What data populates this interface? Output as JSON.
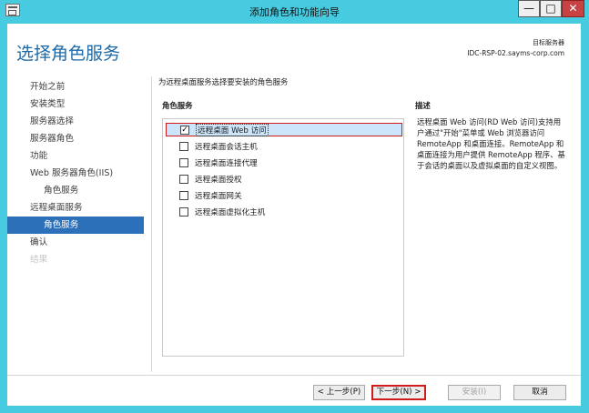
{
  "window": {
    "title": "添加角色和功能向导",
    "min_glyph": "—",
    "max_glyph": "□",
    "close_glyph": "✕",
    "icon": "server-manager-icon"
  },
  "header": {
    "page_title": "选择角色服务",
    "destination_label": "目标服务器",
    "destination_server": "IDC-RSP-02.sayms-corp.com"
  },
  "nav": {
    "items": [
      {
        "label": "开始之前",
        "state": "normal"
      },
      {
        "label": "安装类型",
        "state": "normal"
      },
      {
        "label": "服务器选择",
        "state": "normal"
      },
      {
        "label": "服务器角色",
        "state": "normal"
      },
      {
        "label": "功能",
        "state": "normal"
      },
      {
        "label": "Web 服务器角色(IIS)",
        "state": "normal"
      },
      {
        "label": "角色服务",
        "state": "sub"
      },
      {
        "label": "远程桌面服务",
        "state": "normal"
      },
      {
        "label": "角色服务",
        "state": "sub-active"
      },
      {
        "label": "确认",
        "state": "normal"
      },
      {
        "label": "结果",
        "state": "disabled"
      }
    ]
  },
  "main": {
    "instruction": "为远程桌面服务选择要安装的角色服务",
    "roles_label": "角色服务",
    "roles": [
      {
        "label": "远程桌面 Web 访问",
        "checked": true,
        "highlighted": true
      },
      {
        "label": "远程桌面会话主机",
        "checked": false
      },
      {
        "label": "远程桌面连接代理",
        "checked": false
      },
      {
        "label": "远程桌面授权",
        "checked": false
      },
      {
        "label": "远程桌面网关",
        "checked": false
      },
      {
        "label": "远程桌面虚拟化主机",
        "checked": false
      }
    ],
    "check_glyph": "✓",
    "description_label": "描述",
    "description_text": "远程桌面 Web 访问(RD Web 访问)支持用户通过\"开始\"菜单或 Web 浏览器访问 RemoteApp 和桌面连接。RemoteApp 和桌面连接为用户提供 RemoteApp 程序、基于会话的桌面以及虚拟桌面的自定义视图。"
  },
  "footer": {
    "prev_label": "< 上一步(P)",
    "next_label": "下一步(N) >",
    "install_label": "安装(I)",
    "cancel_label": "取消"
  },
  "colors": {
    "frame": "#47cbe0",
    "accent": "#2c70b9",
    "title_text": "#1e6aa8",
    "highlight_border": "#d11a1a"
  }
}
